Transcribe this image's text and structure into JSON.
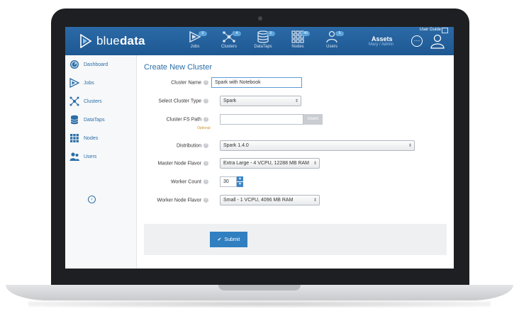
{
  "app": {
    "brand_light": "blue",
    "brand_bold": "data",
    "user_guide": "User Guide",
    "assets_title": "Assets",
    "assets_user": "Mary / Admin"
  },
  "nav": [
    {
      "label": "Jobs",
      "badge": "0",
      "icon": "jobs-icon"
    },
    {
      "label": "Clusters",
      "badge": "4",
      "icon": "clusters-icon"
    },
    {
      "label": "DataTaps",
      "badge": "5",
      "icon": "datataps-icon"
    },
    {
      "label": "Nodes",
      "badge": "40",
      "icon": "nodes-icon"
    },
    {
      "label": "Users",
      "badge": "5",
      "icon": "users-icon"
    }
  ],
  "sidebar": [
    {
      "label": "Dashboard",
      "icon": "dashboard-icon"
    },
    {
      "label": "Jobs",
      "icon": "jobs-icon"
    },
    {
      "label": "Clusters",
      "icon": "clusters-icon"
    },
    {
      "label": "DataTaps",
      "icon": "datataps-icon"
    },
    {
      "label": "Nodes",
      "icon": "nodes-icon"
    },
    {
      "label": "Users",
      "icon": "users-icon"
    }
  ],
  "form": {
    "title": "Create New Cluster",
    "cluster_name_label": "Cluster Name",
    "cluster_name_value": "Spark with Notebook",
    "cluster_type_label": "Select Cluster Type",
    "cluster_type_value": "Spark",
    "fs_path_label": "Cluster FS Path",
    "fs_path_optional": "Optional",
    "insert_label": "Insert",
    "distribution_label": "Distribution",
    "distribution_value": "Spark 1.4.0",
    "master_flavor_label": "Master Node Flavor",
    "master_flavor_value": "Extra Large - 4 VCPU, 12288 MB RAM",
    "worker_count_label": "Worker Count",
    "worker_count_value": "30",
    "worker_flavor_label": "Worker Node Flavor",
    "worker_flavor_value": "Small - 1 VCPU, 4096 MB RAM",
    "submit_label": "Submit"
  },
  "colors": {
    "header": "#1e5892",
    "accent": "#2a6ea8",
    "submit": "#2f7fc1",
    "optional": "#c9962a"
  }
}
